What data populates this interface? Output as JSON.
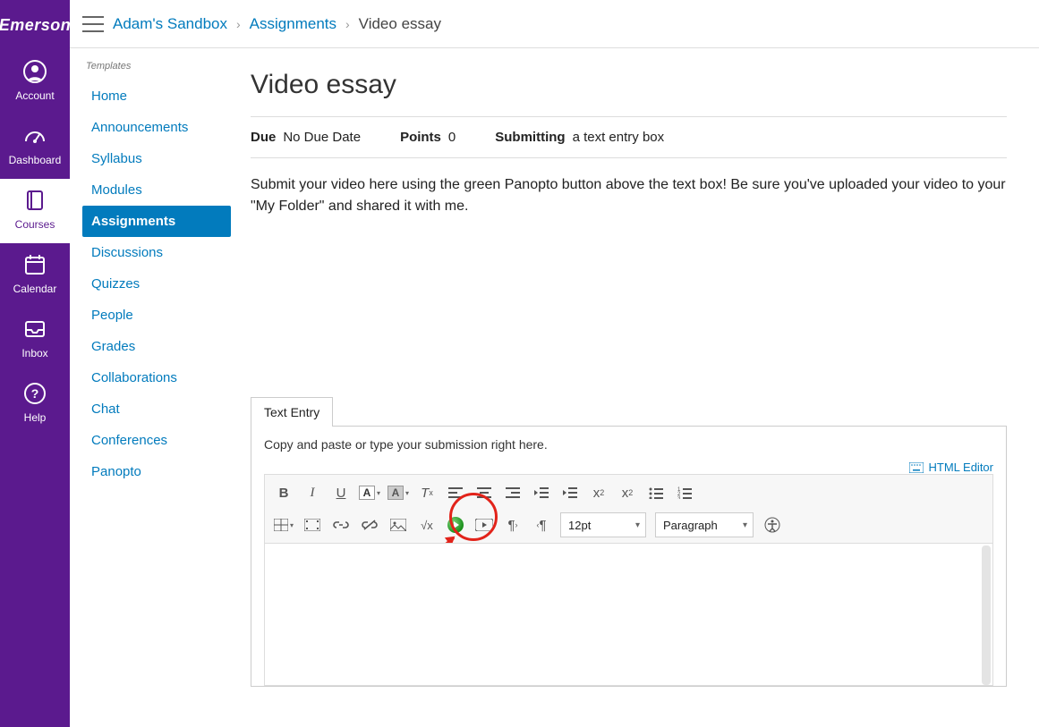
{
  "brand": "Emerson",
  "global_nav": [
    {
      "id": "account",
      "label": "Account"
    },
    {
      "id": "dashboard",
      "label": "Dashboard"
    },
    {
      "id": "courses",
      "label": "Courses",
      "active": true
    },
    {
      "id": "calendar",
      "label": "Calendar"
    },
    {
      "id": "inbox",
      "label": "Inbox"
    },
    {
      "id": "help",
      "label": "Help"
    }
  ],
  "breadcrumbs": {
    "root": "Adam's Sandbox",
    "mid": "Assignments",
    "leaf": "Video essay"
  },
  "course_nav_header": "Templates",
  "course_nav": [
    {
      "label": "Home"
    },
    {
      "label": "Announcements"
    },
    {
      "label": "Syllabus"
    },
    {
      "label": "Modules"
    },
    {
      "label": "Assignments",
      "active": true
    },
    {
      "label": "Discussions"
    },
    {
      "label": "Quizzes"
    },
    {
      "label": "People"
    },
    {
      "label": "Grades"
    },
    {
      "label": "Collaborations"
    },
    {
      "label": "Chat"
    },
    {
      "label": "Conferences"
    },
    {
      "label": "Panopto"
    }
  ],
  "page": {
    "title": "Video essay",
    "due_label": "Due",
    "due_value": "No Due Date",
    "points_label": "Points",
    "points_value": "0",
    "submitting_label": "Submitting",
    "submitting_value": "a text entry box",
    "description": "Submit your video here using the green Panopto button above the text box! Be sure you've uploaded your video to your \"My Folder\" and shared it with me."
  },
  "editor": {
    "tab": "Text Entry",
    "hint": "Copy and paste or type your submission right here.",
    "html_editor": "HTML Editor",
    "font_size": "12pt",
    "block": "Paragraph"
  }
}
